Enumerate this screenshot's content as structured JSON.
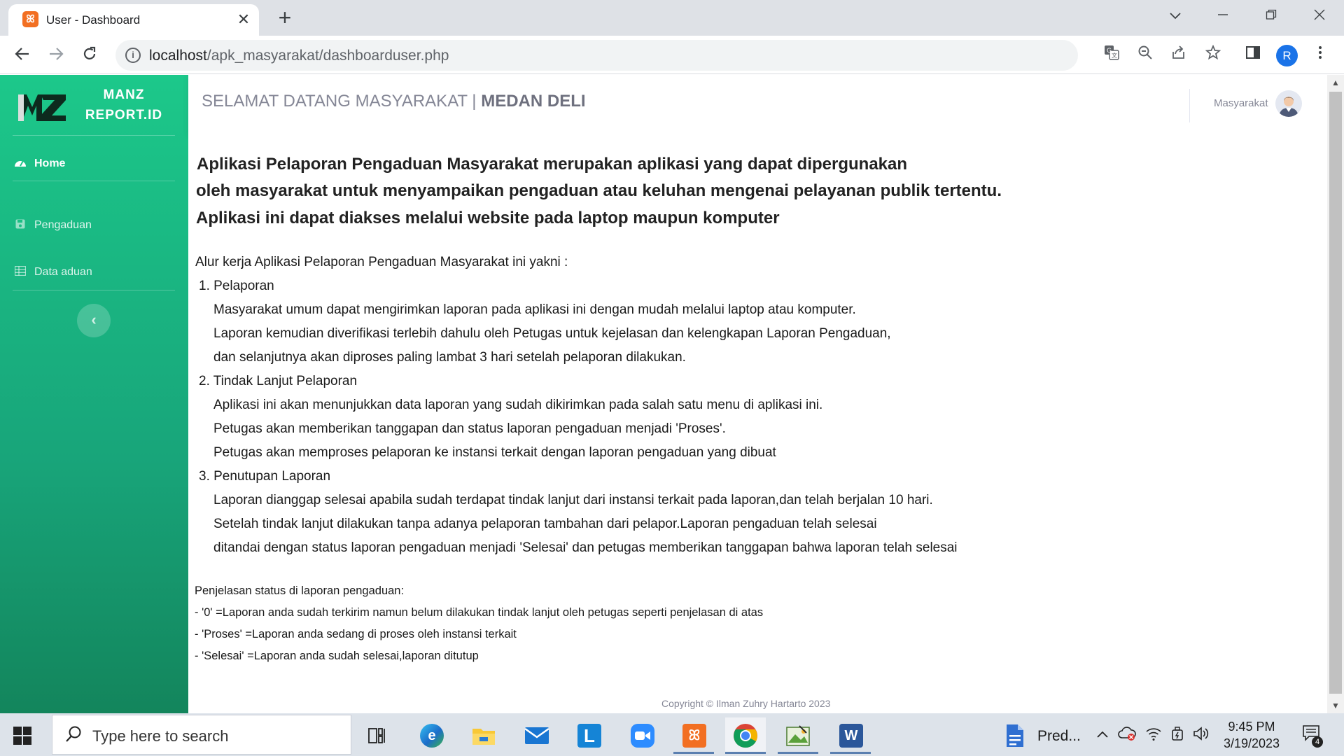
{
  "browser": {
    "tab_title": "User - Dashboard",
    "new_tab": "+",
    "url_host": "localhost",
    "url_path": "/apk_masyarakat/dashboarduser.php",
    "profile_initial": "R"
  },
  "sidebar": {
    "brand_line1": "MANZ",
    "brand_line2": "REPORT.ID",
    "items": [
      {
        "label": "Home",
        "icon": "tachometer-icon"
      },
      {
        "label": "Pengaduan",
        "icon": "save-icon"
      },
      {
        "label": "Data aduan",
        "icon": "table-icon"
      }
    ],
    "toggle_icon": "chevron-left-icon"
  },
  "topbar": {
    "welcome_prefix": "SELAMAT DATANG MASYARAKAT | ",
    "welcome_city": "MEDAN DELI",
    "user_name": "Masyarakat"
  },
  "content": {
    "intro": [
      " Aplikasi Pelaporan Pengaduan Masyarakat merupakan aplikasi yang dapat dipergunakan",
      "oleh masyarakat untuk menyampaikan pengaduan atau keluhan mengenai pelayanan publik tertentu.",
      "Aplikasi ini dapat diakses melalui website pada laptop maupun komputer"
    ],
    "workflow_title": "Alur kerja Aplikasi Pelaporan Pengaduan Masyarakat ini yakni :",
    "steps": [
      {
        "title": "1. Pelaporan",
        "lines": [
          "Masyarakat umum dapat mengirimkan laporan pada aplikasi ini dengan mudah melalui laptop atau komputer.",
          "Laporan kemudian diverifikasi terlebih dahulu oleh Petugas untuk kejelasan dan kelengkapan Laporan Pengaduan,",
          "dan selanjutnya akan diproses paling lambat 3 hari setelah pelaporan dilakukan."
        ]
      },
      {
        "title": "2. Tindak Lanjut Pelaporan",
        "lines": [
          "Aplikasi ini akan menunjukkan data laporan yang sudah dikirimkan pada salah satu menu di aplikasi ini.",
          "Petugas akan memberikan tanggapan dan status laporan pengaduan menjadi 'Proses'.",
          "Petugas akan memproses pelaporan ke instansi terkait dengan laporan pengaduan yang dibuat"
        ]
      },
      {
        "title": "3. Penutupan Laporan",
        "lines": [
          "Laporan dianggap selesai apabila sudah terdapat tindak lanjut dari instansi terkait pada laporan,dan telah berjalan 10 hari.",
          "Setelah tindak lanjut dilakukan tanpa adanya pelaporan tambahan dari pelapor.Laporan pengaduan telah selesai",
          "ditandai dengan status laporan pengaduan menjadi 'Selesai' dan petugas memberikan tanggapan bahwa laporan telah selesai"
        ]
      }
    ],
    "status_title": "Penjelasan status di laporan pengaduan:",
    "status_lines": [
      "- '0' =Laporan anda sudah terkirim namun belum dilakukan tindak lanjut oleh petugas seperti penjelasan di atas",
      "- 'Proses' =Laporan anda sedang di proses oleh instansi terkait",
      "- 'Selesai' =Laporan anda sudah selesai,laporan ditutup"
    ],
    "copyright": "Copyright © Ilman Zuhry Hartarto 2023"
  },
  "taskbar": {
    "search_placeholder": "Type here to search",
    "pinned_label": "Pred...",
    "time": "9:45 PM",
    "date": "3/19/2023",
    "notification_count": "4"
  }
}
